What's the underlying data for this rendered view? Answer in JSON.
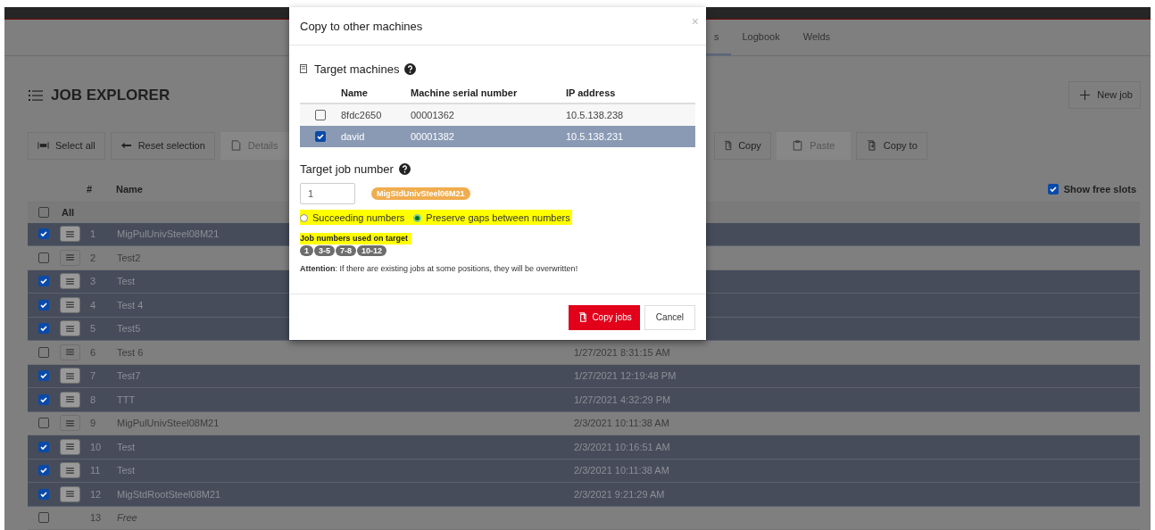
{
  "nav": {
    "tabs": [
      {
        "label": "s",
        "selected": true
      },
      {
        "label": "Logbook",
        "selected": false
      },
      {
        "label": "Welds",
        "selected": false
      }
    ]
  },
  "page_title": "JOB EXPLORER",
  "new_job_button": "New job",
  "toolbar": [
    {
      "label": "Select all",
      "kind": "selectall",
      "disabled": false
    },
    {
      "label": "Reset selection",
      "kind": "reset",
      "disabled": false
    },
    {
      "label": "Details",
      "kind": "details",
      "disabled": true
    },
    {
      "label": "Copy",
      "kind": "copy",
      "disabled": false
    },
    {
      "label": "Paste",
      "kind": "paste",
      "disabled": true
    },
    {
      "label": "Copy to",
      "kind": "copyto",
      "disabled": false
    }
  ],
  "table": {
    "columns": [
      "#",
      "Name"
    ],
    "show_free_slots": {
      "label": "Show free slots",
      "checked": true
    },
    "all_row": {
      "label": "All",
      "checked": false
    },
    "rows": [
      {
        "kind": "job",
        "number": "1",
        "name": "MigPulUnivSteel08M21",
        "selected": true
      },
      {
        "kind": "job",
        "number": "2",
        "name": "Test2",
        "selected": false
      },
      {
        "kind": "job",
        "number": "3",
        "name": "Test",
        "selected": true
      },
      {
        "kind": "job",
        "number": "4",
        "name": "Test 4",
        "selected": true
      },
      {
        "kind": "job",
        "number": "5",
        "name": "Test5",
        "selected": true
      },
      {
        "kind": "job",
        "number": "6",
        "name": "Test 6",
        "selected": false,
        "date": "1/27/2021 8:31:15 AM"
      },
      {
        "kind": "job",
        "number": "7",
        "name": "Test7",
        "selected": true,
        "date": "1/27/2021 12:19:48 PM"
      },
      {
        "kind": "job",
        "number": "8",
        "name": "TTT",
        "selected": true,
        "date": "1/27/2021 4:32:29 PM"
      },
      {
        "kind": "job",
        "number": "9",
        "name": "MigPulUnivSteel08M21",
        "selected": false,
        "date": "2/3/2021 10:11:38 AM"
      },
      {
        "kind": "job",
        "number": "10",
        "name": "Test",
        "selected": true,
        "date": "2/3/2021 10:16:51 AM"
      },
      {
        "kind": "job",
        "number": "11",
        "name": "Test",
        "selected": true,
        "date": "2/3/2021 10:11:38 AM"
      },
      {
        "kind": "job",
        "number": "12",
        "name": "MigStdRootSteel08M21",
        "selected": true,
        "date": "2/3/2021 9:21:29 AM"
      },
      {
        "kind": "free",
        "number": "13",
        "name": "Free",
        "selected": false
      }
    ]
  },
  "dialog": {
    "title": "Copy to other machines",
    "close": "×",
    "machines_heading": "Target machines",
    "machine_columns": [
      "Name",
      "Machine serial number",
      "IP address"
    ],
    "machines": [
      {
        "name": "8fdc2650",
        "serial": "00001362",
        "ip": "10.5.138.238",
        "selected": false
      },
      {
        "name": "david",
        "serial": "00001382",
        "ip": "10.5.138.231",
        "selected": true
      }
    ],
    "job_number_heading": "Target job number",
    "job_number": "1",
    "job_badge": "MigStdUnivSteel06M21",
    "numbering": {
      "highlighted": true,
      "options": [
        {
          "label": "Succeeding numbers",
          "selected": false
        },
        {
          "label": "Preserve gaps between numbers",
          "selected": true
        }
      ]
    },
    "used_label": {
      "text": "Job numbers used on target",
      "highlighted": true
    },
    "used_numbers": [
      "1",
      "3-5",
      "7-8",
      "10-12"
    ],
    "attention": "**Attention**: If there are existing jobs at some positions, they will be overwritten!",
    "buttons": [
      {
        "label": "Copy jobs",
        "kind": "primary"
      },
      {
        "label": "Cancel",
        "kind": "secondary"
      }
    ]
  }
}
